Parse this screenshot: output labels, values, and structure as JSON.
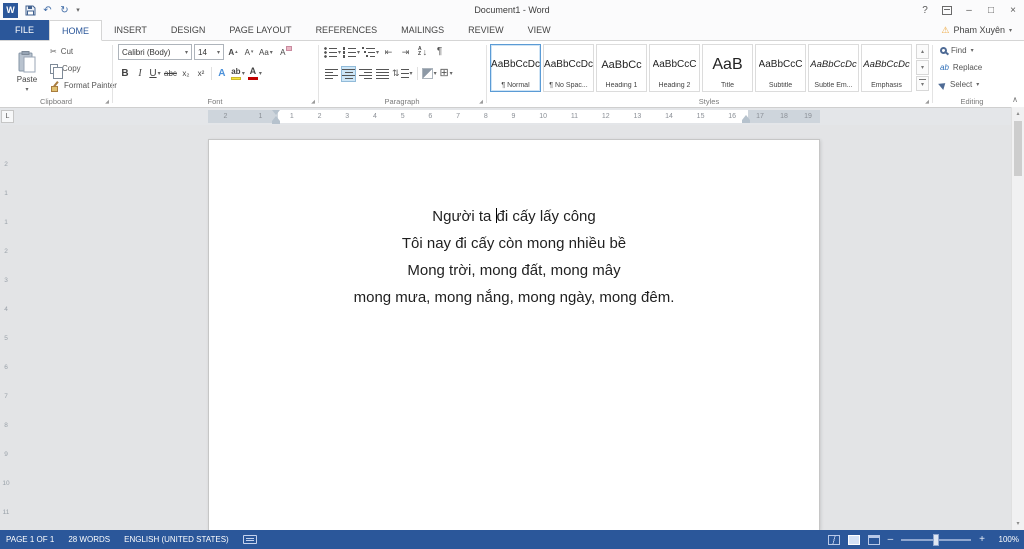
{
  "titlebar": {
    "title": "Document1 - Word"
  },
  "icons": {
    "word": "W",
    "undo": "↶",
    "redo": "↻",
    "chevron_down": "▾",
    "chevron_up": "▴",
    "help": "?",
    "minimize": "–",
    "maximize": "□",
    "close": "×",
    "warning": "⚠",
    "scissors": "✂",
    "pilcrow": "¶",
    "borders": "⊞",
    "collapse": "∧",
    "launcher": "◢",
    "outdent": "⇤",
    "indent": "⇥",
    "updown": "⇅",
    "arrow_down": "↓",
    "replace_ab": "ab",
    "zoom_out": "–",
    "zoom_in": "+"
  },
  "tabs": [
    {
      "label": "FILE"
    },
    {
      "label": "HOME"
    },
    {
      "label": "INSERT"
    },
    {
      "label": "DESIGN"
    },
    {
      "label": "PAGE LAYOUT"
    },
    {
      "label": "REFERENCES"
    },
    {
      "label": "MAILINGS"
    },
    {
      "label": "REVIEW"
    },
    {
      "label": "VIEW"
    }
  ],
  "account": {
    "name": "Pham Xuyên"
  },
  "ribbon": {
    "clipboard": {
      "label": "Clipboard",
      "paste": "Paste",
      "cut": "Cut",
      "copy": "Copy",
      "format_painter": "Format Painter"
    },
    "font": {
      "label": "Font",
      "family": "Calibri (Body)",
      "size": "14",
      "bold": "B",
      "italic": "I",
      "underline": "U",
      "strike": "abc",
      "subscript": "x₂",
      "superscript": "x²",
      "grow": "A",
      "shrink": "A",
      "change_case": "Aa",
      "clear": "A",
      "effects": "A",
      "highlight": "ab",
      "color": "A"
    },
    "paragraph": {
      "label": "Paragraph",
      "sort_a": "A",
      "sort_z": "Z"
    },
    "styles": {
      "label": "Styles",
      "items": [
        {
          "preview": "AaBbCcDc",
          "name": "¶ Normal"
        },
        {
          "preview": "AaBbCcDc",
          "name": "¶ No Spac..."
        },
        {
          "preview": "AaBbCc",
          "name": "Heading 1"
        },
        {
          "preview": "AaBbCcC",
          "name": "Heading 2"
        },
        {
          "preview": "AaB",
          "name": "Title"
        },
        {
          "preview": "AaBbCcC",
          "name": "Subtitle"
        },
        {
          "preview": "AaBbCcDc",
          "name": "Subtle Em..."
        },
        {
          "preview": "AaBbCcDc",
          "name": "Emphasis"
        }
      ]
    },
    "editing": {
      "label": "Editing",
      "find": "Find",
      "replace": "Replace",
      "select": "Select"
    }
  },
  "ruler": {
    "tab_selector": "L",
    "left": [
      "2",
      "1"
    ],
    "center": [
      "1",
      "2",
      "3",
      "4",
      "5",
      "6",
      "7",
      "8",
      "9",
      "10",
      "11",
      "12",
      "13",
      "14",
      "15",
      "16"
    ],
    "right": [
      "17",
      "18",
      "19"
    ],
    "vertical": [
      "2",
      "1",
      "1",
      "2",
      "3",
      "4",
      "5",
      "6",
      "7",
      "8",
      "9",
      "10",
      "11"
    ]
  },
  "document": {
    "caret_line": {
      "before": "Người ta ",
      "after": "đi cấy lấy công"
    },
    "lines": [
      "Tôi nay đi cấy còn mong nhiều bề",
      "Mong trời, mong đất, mong mây",
      "mong mưa, mong nắng, mong ngày, mong đêm."
    ]
  },
  "statusbar": {
    "page": "PAGE 1 OF 1",
    "words": "28 WORDS",
    "language": "ENGLISH (UNITED STATES)",
    "zoom": "100%"
  }
}
